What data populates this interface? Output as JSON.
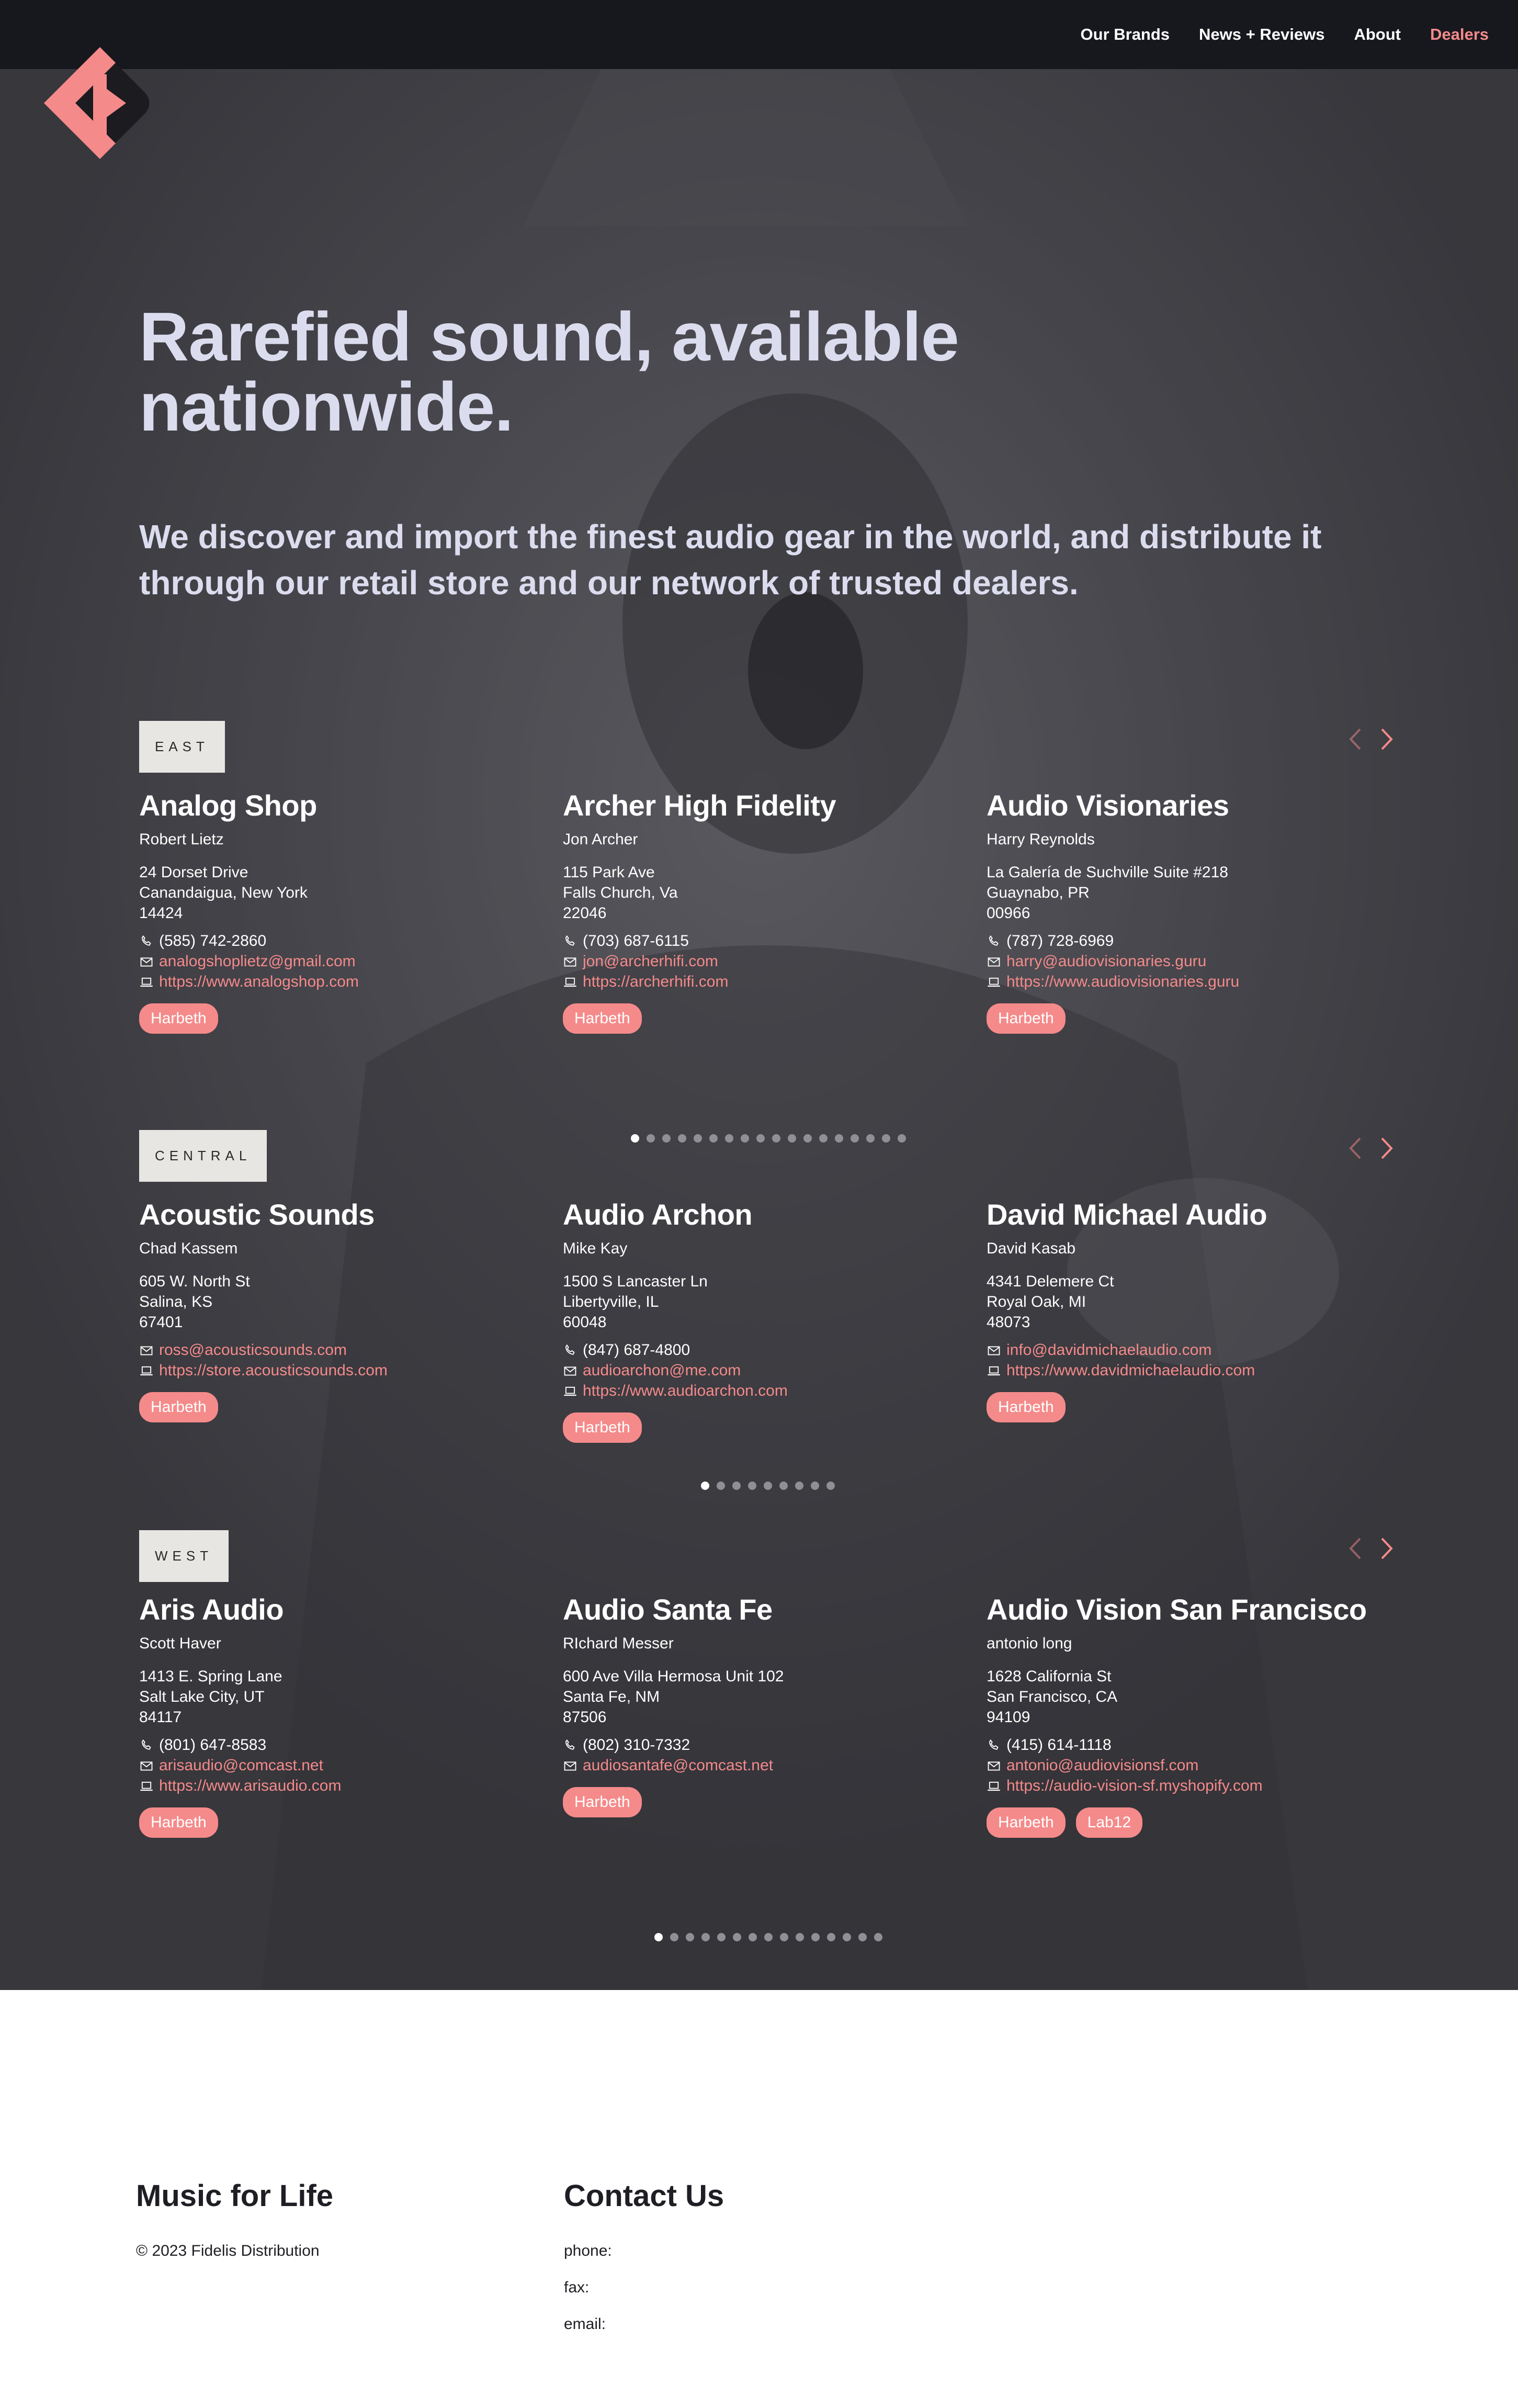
{
  "nav": {
    "items": [
      {
        "label": "Our Brands",
        "active": false
      },
      {
        "label": "News + Reviews",
        "active": false
      },
      {
        "label": "About",
        "active": false
      },
      {
        "label": "Dealers",
        "active": true
      }
    ]
  },
  "logo": {
    "icon": "fidelis-logo-icon",
    "colors": {
      "primary": "#f58a8a",
      "secondary": "#1b1b20"
    }
  },
  "hero": {
    "headline": "Rarefied sound, available nationwide.",
    "subhead": "We discover and import the finest audio gear in the world, and distribute it through our retail store and our network of trusted dealers."
  },
  "colors": {
    "accent": "#f58a8a",
    "text_light": "#dcdcef",
    "tag_bg": "#e7e6e2",
    "nav_bg": "#17181e"
  },
  "regions": [
    {
      "name": "EAST",
      "dot_count": 18,
      "active_dot": 0,
      "dealers": [
        {
          "name": "Analog Shop",
          "contact": "Robert Lietz",
          "address": [
            "24 Dorset Drive",
            "Canandaigua, New York",
            "14424"
          ],
          "phone": "(585) 742-2860",
          "email": "analogshoplietz@gmail.com",
          "website": "https://www.analogshop.com",
          "brands": [
            "Harbeth"
          ]
        },
        {
          "name": "Archer High Fidelity",
          "contact": "Jon Archer",
          "address": [
            "115 Park Ave",
            "Falls Church, Va",
            "22046"
          ],
          "phone": "(703) 687-6115",
          "email": "jon@archerhifi.com",
          "website": "https://archerhifi.com",
          "brands": [
            "Harbeth"
          ]
        },
        {
          "name": "Audio Visionaries",
          "contact": "Harry Reynolds",
          "address": [
            "La Galería de Suchville Suite #218",
            "Guaynabo, PR",
            "00966"
          ],
          "phone": "(787) 728-6969",
          "email": "harry@audiovisionaries.guru",
          "website": "https://www.audiovisionaries.guru",
          "brands": [
            "Harbeth"
          ]
        }
      ]
    },
    {
      "name": "CENTRAL",
      "dot_count": 9,
      "active_dot": 0,
      "dealers": [
        {
          "name": "Acoustic Sounds",
          "contact": "Chad Kassem",
          "address": [
            "605 W. North St",
            "Salina, KS",
            "67401"
          ],
          "phone": null,
          "email": "ross@acousticsounds.com",
          "website": "https://store.acousticsounds.com",
          "brands": [
            "Harbeth"
          ]
        },
        {
          "name": "Audio Archon",
          "contact": "Mike Kay",
          "address": [
            "1500 S Lancaster Ln",
            "Libertyville, IL",
            "60048"
          ],
          "phone": "(847) 687-4800",
          "email": "audioarchon@me.com",
          "website": "https://www.audioarchon.com",
          "brands": [
            "Harbeth"
          ]
        },
        {
          "name": "David Michael Audio",
          "contact": "David Kasab",
          "address": [
            "4341 Delemere Ct",
            "Royal Oak, MI",
            "48073"
          ],
          "phone": null,
          "email": "info@davidmichaelaudio.com",
          "website": "https://www.davidmichaelaudio.com",
          "brands": [
            "Harbeth"
          ]
        }
      ]
    },
    {
      "name": "WEST",
      "dot_count": 15,
      "active_dot": 0,
      "dealers": [
        {
          "name": "Aris Audio",
          "contact": "Scott Haver",
          "address": [
            "1413 E. Spring Lane",
            "Salt Lake City, UT",
            "84117"
          ],
          "phone": "(801) 647-8583",
          "email": "arisaudio@comcast.net",
          "website": "https://www.arisaudio.com",
          "brands": [
            "Harbeth"
          ]
        },
        {
          "name": "Audio Santa Fe",
          "contact": "RIchard Messer",
          "address": [
            "600 Ave Villa Hermosa Unit 102",
            "Santa Fe, NM",
            "87506"
          ],
          "phone": "(802) 310-7332",
          "email": "audiosantafe@comcast.net",
          "website": null,
          "brands": [
            "Harbeth"
          ]
        },
        {
          "name": "Audio Vision San Francisco",
          "contact": "antonio long",
          "address": [
            "1628 California St",
            "San Francisco, CA",
            "94109"
          ],
          "phone": "(415) 614-1118",
          "email": "antonio@audiovisionsf.com",
          "website": "https://audio-vision-sf.myshopify.com",
          "brands": [
            "Harbeth",
            "Lab12"
          ]
        }
      ]
    }
  ],
  "footer": {
    "tagline": "Music for Life",
    "copyright": "© 2023 Fidelis Distribution",
    "contact_title": "Contact Us",
    "phone_label": "phone:",
    "fax_label": "fax:",
    "email_label": "email:"
  }
}
